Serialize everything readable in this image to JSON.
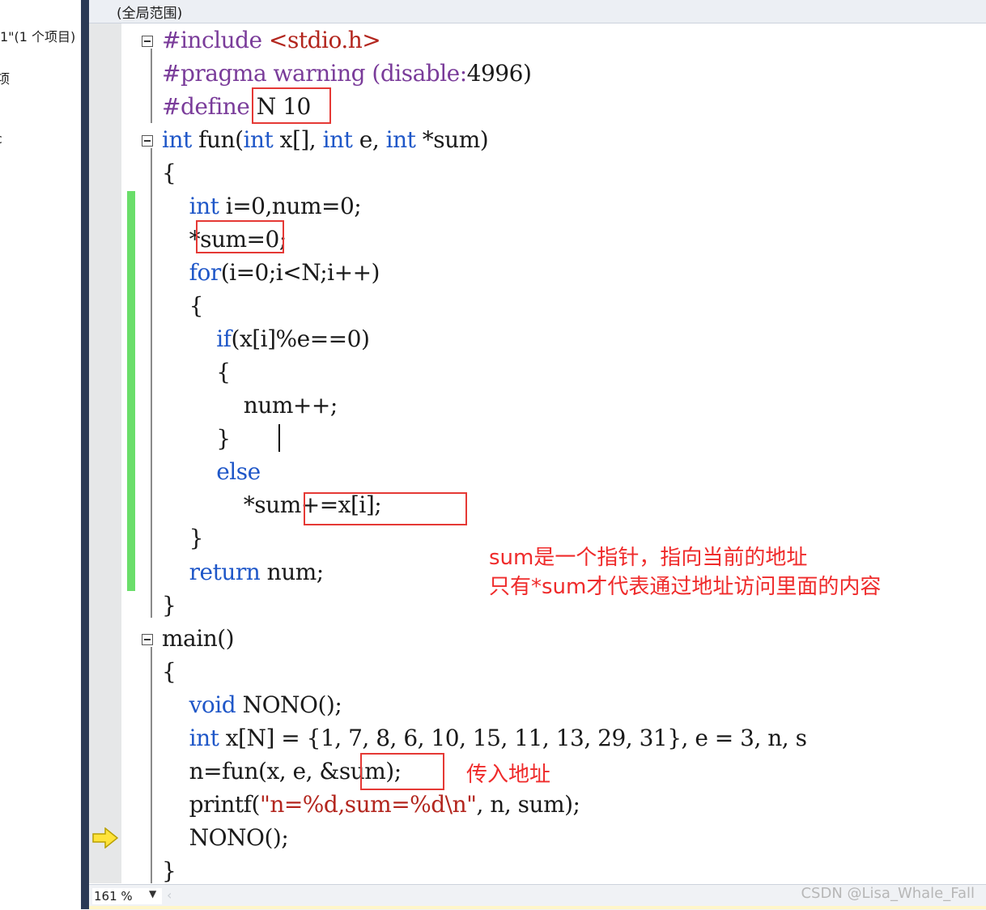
{
  "solution_explorer": {
    "items": [
      "1\"(1 个项目)",
      "项",
      "c"
    ]
  },
  "scope_bar": {
    "label": "(全局范围)"
  },
  "code_lines": [
    [
      {
        "t": "#include ",
        "c": "pp"
      },
      {
        "t": "<stdio.h>",
        "c": "str"
      }
    ],
    [
      {
        "t": "#pragma warning ",
        "c": "pp"
      },
      {
        "t": "(disable:",
        "c": "pp"
      },
      {
        "t": "4996",
        "c": "txt"
      },
      {
        "t": ")",
        "c": "txt"
      }
    ],
    [
      {
        "t": "#define",
        "c": "pp"
      },
      {
        "t": " N 10",
        "c": "txt"
      }
    ],
    [
      {
        "t": "int",
        "c": "kw"
      },
      {
        "t": " fun(",
        "c": "txt"
      },
      {
        "t": "int",
        "c": "kw"
      },
      {
        "t": " x[], ",
        "c": "txt"
      },
      {
        "t": "int",
        "c": "kw"
      },
      {
        "t": " e, ",
        "c": "txt"
      },
      {
        "t": "int",
        "c": "kw"
      },
      {
        "t": " *sum)",
        "c": "txt"
      }
    ],
    [
      {
        "t": "{",
        "c": "txt"
      }
    ],
    [
      {
        "t": "    ",
        "c": "txt"
      },
      {
        "t": "int",
        "c": "kw"
      },
      {
        "t": " i=0,num=0;",
        "c": "txt"
      }
    ],
    [
      {
        "t": "    *sum=0;",
        "c": "txt"
      }
    ],
    [
      {
        "t": "    ",
        "c": "txt"
      },
      {
        "t": "for",
        "c": "kw"
      },
      {
        "t": "(i=0;i<N;i++)",
        "c": "txt"
      }
    ],
    [
      {
        "t": "    {",
        "c": "txt"
      }
    ],
    [
      {
        "t": "        ",
        "c": "txt"
      },
      {
        "t": "if",
        "c": "kw"
      },
      {
        "t": "(x[i]%e==0)",
        "c": "txt"
      }
    ],
    [
      {
        "t": "        {",
        "c": "txt"
      }
    ],
    [
      {
        "t": "            num++;",
        "c": "txt"
      }
    ],
    [
      {
        "t": "        }",
        "c": "txt"
      }
    ],
    [
      {
        "t": "        ",
        "c": "txt"
      },
      {
        "t": "else",
        "c": "kw"
      }
    ],
    [
      {
        "t": "            *sum+=x[i];",
        "c": "txt"
      }
    ],
    [
      {
        "t": "    }",
        "c": "txt"
      }
    ],
    [
      {
        "t": "    ",
        "c": "txt"
      },
      {
        "t": "return",
        "c": "kw"
      },
      {
        "t": " num;",
        "c": "txt"
      }
    ],
    [
      {
        "t": "}",
        "c": "txt"
      }
    ],
    [
      {
        "t": "main()",
        "c": "txt"
      }
    ],
    [
      {
        "t": "{",
        "c": "txt"
      }
    ],
    [
      {
        "t": "    ",
        "c": "txt"
      },
      {
        "t": "void",
        "c": "kw"
      },
      {
        "t": " NONO();",
        "c": "txt"
      }
    ],
    [
      {
        "t": "    ",
        "c": "txt"
      },
      {
        "t": "int",
        "c": "kw"
      },
      {
        "t": " x[N] = {1, 7, 8, 6, 10, 15, 11, 13, 29, 31}, e = 3, n, s",
        "c": "txt"
      }
    ],
    [
      {
        "t": "    n=fun(x, e, &sum);",
        "c": "txt"
      }
    ],
    [
      {
        "t": "    printf(",
        "c": "txt"
      },
      {
        "t": "\"n=%d,sum=%d\\n\"",
        "c": "str"
      },
      {
        "t": ", n, sum);",
        "c": "txt"
      }
    ],
    [
      {
        "t": "    NONO();",
        "c": "txt"
      }
    ],
    [
      {
        "t": "}",
        "c": "txt"
      }
    ]
  ],
  "annotations": {
    "note_line1": "sum是一个指针，指向当前的地址",
    "note_line2": "只有*sum才代表通过地址访问里面的内容",
    "pass_address": "传入地址"
  },
  "status_bar": {
    "zoom": "161 %"
  },
  "watermark": "CSDN @Lisa_Whale_Fall",
  "colors": {
    "keyword": "#1f57c8",
    "preprocessor": "#7a3c9a",
    "string": "#b3261e",
    "annotation": "#ef2b2b",
    "change_bar": "#6ade6a"
  }
}
